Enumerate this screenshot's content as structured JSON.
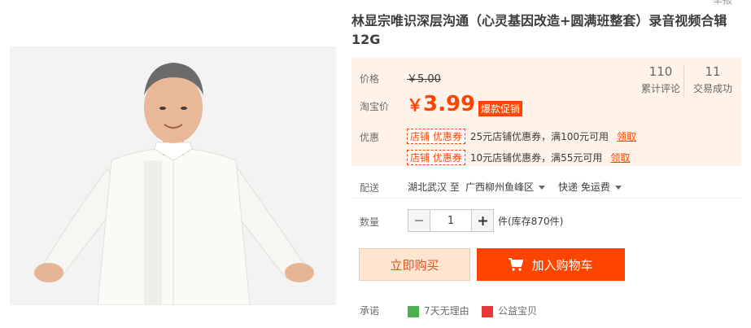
{
  "top_cut_text": "举报",
  "title": "林显宗唯识深层沟通（心灵基因改造+圆满班整套）录音视频合辑12G",
  "price": {
    "label": "价格",
    "old_price": "￥5.00",
    "taobao_label": "淘宝价",
    "yen": "￥",
    "taobao_price": "3.99",
    "hot_tag": "爆款促销"
  },
  "stats": [
    {
      "number": "110",
      "label": "累计评论"
    },
    {
      "number": "11",
      "label": "交易成功"
    }
  ],
  "coupons": {
    "label": "优惠",
    "items": [
      {
        "tag": "店铺 优惠券",
        "text": "25元店铺优惠券，满100元可用",
        "link": "领取"
      },
      {
        "tag": "店铺 优惠券",
        "text": "10元店铺优惠券，满55元可用",
        "link": "领取"
      }
    ]
  },
  "delivery": {
    "label": "配送",
    "from": "湖北武汉 至",
    "to": "广西柳州鱼峰区",
    "method": "快递 免运费"
  },
  "quantity": {
    "label": "数量",
    "value": "1",
    "stock": "件(库存870件)"
  },
  "buttons": {
    "buy_now": "立即购买",
    "add_cart": "加入购物车"
  },
  "bottom": {
    "label": "承诺",
    "item1": "7天无理由",
    "item2": "公益宝贝"
  },
  "colors": {
    "accent": "#ff4400",
    "price_panel_bg": "#fff2e8",
    "buy_now_bg": "#ffe4d0"
  }
}
